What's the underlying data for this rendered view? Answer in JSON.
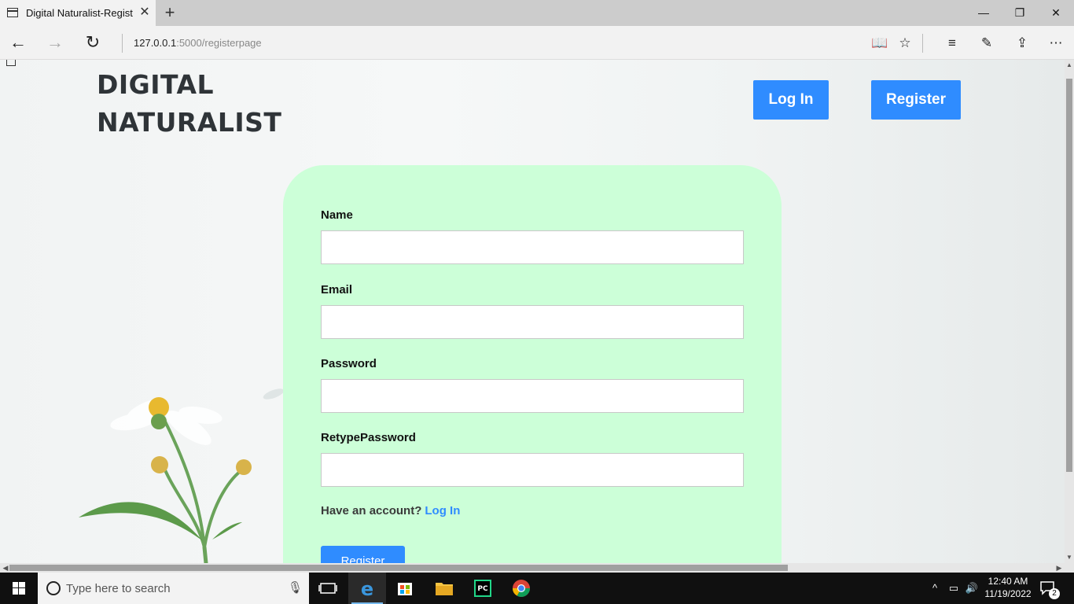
{
  "browser": {
    "tab_title": "Digital Naturalist-Regist",
    "tab_close": "✕",
    "new_tab": "+",
    "url_host": "127.0.0.1",
    "url_path": ":5000/registerpage",
    "window_controls": {
      "minimize": "—",
      "maximize": "❐",
      "close": "✕"
    },
    "nav": {
      "back": "←",
      "forward": "→",
      "refresh": "↻"
    },
    "tools": {
      "reading_view": "📖",
      "favorite": "☆",
      "hub": "≡",
      "notes": "✎",
      "share": "⇪",
      "more": "⋯"
    }
  },
  "header": {
    "logo_line1": "DIGITAL",
    "logo_line2": "NATURALIST",
    "login_label": "Log In",
    "register_label": "Register"
  },
  "form": {
    "name_label": "Name",
    "email_label": "Email",
    "password_label": "Password",
    "retype_label": "RetypePassword",
    "name_value": "",
    "email_value": "",
    "password_value": "",
    "retype_value": "",
    "account_prompt": "Have an account?",
    "login_link": "Log In",
    "submit_label": "Register"
  },
  "taskbar": {
    "search_placeholder": "Type here to search",
    "time": "12:40 AM",
    "date": "11/19/2022",
    "notification_count": "2",
    "tray_chevron": "^",
    "volume": "🔊"
  },
  "colors": {
    "accent": "#2f8cff",
    "card_bg": "#ccffd8",
    "logo_text": "#2f3438"
  }
}
